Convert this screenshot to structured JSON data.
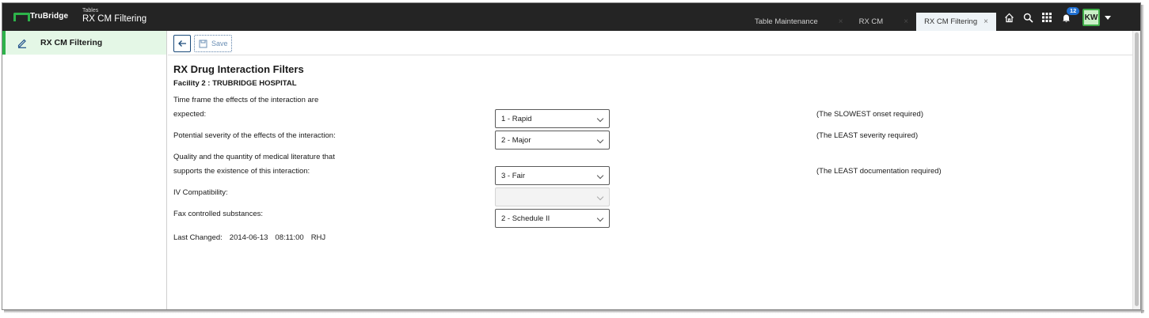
{
  "app": {
    "brand": "TruBridge",
    "breadcrumb": "Tables",
    "page_title": "RX CM Filtering"
  },
  "tabs": [
    {
      "label": "Table Maintenance",
      "close": "×"
    },
    {
      "label": "RX CM",
      "close": "×"
    },
    {
      "label": "RX CM Filtering",
      "close": "×",
      "active": true
    }
  ],
  "header_icons": {
    "notifications_count": "12",
    "user_initials": "KW"
  },
  "sidebar": {
    "items": [
      {
        "label": "RX CM Filtering",
        "icon": "pencil-icon"
      }
    ]
  },
  "toolbar": {
    "save_label": "Save"
  },
  "form": {
    "title": "RX Drug Interaction Filters",
    "facility": "Facility 2 : TRUBRIDGE HOSPITAL",
    "fields": [
      {
        "label_line1": "Time frame the effects of the interaction are",
        "label_line2": "expected:",
        "value": "1 - Rapid",
        "note": "(The SLOWEST onset required)"
      },
      {
        "label_line1": "Potential severity of the effects of the interaction:",
        "value": "2 - Major",
        "note": "(The LEAST severity required)"
      },
      {
        "label_line1": "Quality and the quantity of medical literature that",
        "label_line2": "supports the existence of this interaction:",
        "value": "3 - Fair",
        "note": "(The LEAST documentation required)"
      },
      {
        "label_line1": "IV Compatibility:",
        "value": "",
        "disabled": true
      },
      {
        "label_line1": "Fax controlled substances:",
        "value": "2 - Schedule II"
      }
    ],
    "last_changed_label": "Last Changed:",
    "last_changed_date": "2014-06-13",
    "last_changed_time": "08:11:00",
    "last_changed_user": "RHJ"
  },
  "colors": {
    "topbar": "#242424",
    "accent_green": "#2db34a",
    "badge_blue": "#1f6fd1"
  }
}
